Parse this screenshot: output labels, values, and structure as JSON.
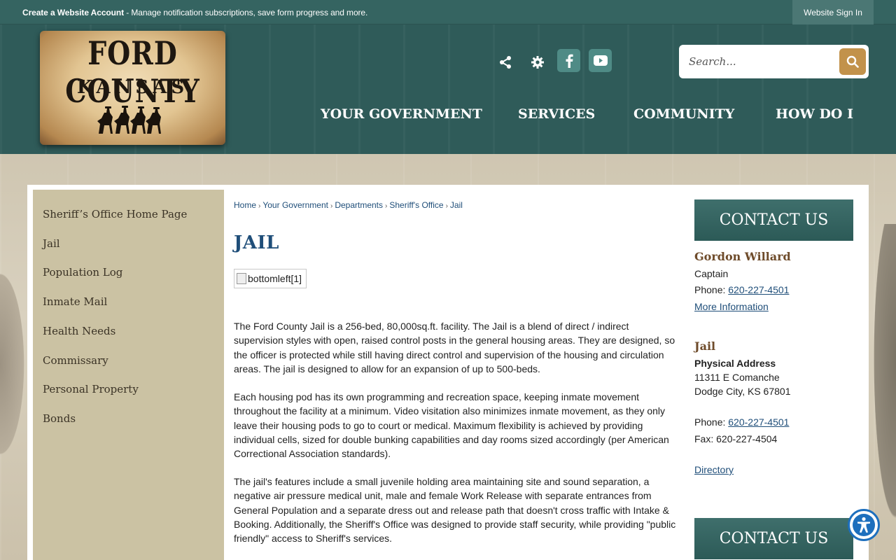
{
  "topbar": {
    "account_bold": "Create a Website Account",
    "account_rest": " - Manage notification subscriptions, save form progress and more.",
    "signin": "Website Sign In"
  },
  "logo": {
    "line1": "FORD COUNTY",
    "line2": "KANSAS"
  },
  "social": {
    "icons": [
      "share-icon",
      "gear-icon",
      "facebook-icon",
      "youtube-icon"
    ]
  },
  "search": {
    "placeholder": "Search..."
  },
  "nav": [
    "YOUR GOVERNMENT",
    "SERVICES",
    "COMMUNITY",
    "HOW DO I"
  ],
  "sidebar": {
    "items": [
      "Sheriff’s Office Home Page",
      "Jail",
      "Population Log",
      "Inmate Mail",
      "Health Needs",
      "Commissary",
      "Personal Property",
      "Bonds"
    ]
  },
  "breadcrumb": [
    "Home",
    "Your Government",
    "Departments",
    "Sheriff's Office",
    "Jail"
  ],
  "page": {
    "title": "JAIL",
    "image_alt": "bottomleft[1]",
    "paragraphs": [
      "The Ford County Jail is a 256-bed, 80,000sq.ft. facility. The Jail is a blend of direct / indirect supervision styles with open, raised control posts in the general housing areas. They are designed, so the officer is protected while still having direct control and supervision of the housing and circulation areas. The jail is designed to allow for an expansion of up to 500-beds.",
      "Each housing pod has its own programming and recreation space, keeping inmate movement throughout the facility at a minimum. Video visitation also minimizes inmate movement, as they only leave their housing pods to go to court or medical. Maximum flexibility is achieved by providing individual cells, sized for double bunking capabilities and day rooms sized accordingly (per American Correctional Association standards).",
      "The jail's features include a small juvenile holding area maintaining site and sound separation, a negative air pressure medical unit, male and female Work Release with separate entrances from General Population and a separate dress out and release path that doesn't cross traffic with Intake & Booking. Additionally, the Sheriff's Office was designed to provide staff security, while providing \"public friendly\" access to Sheriff's services."
    ]
  },
  "contact": {
    "heading": "CONTACT US",
    "person": {
      "name": "Gordon Willard",
      "role": "Captain",
      "phone_label": "Phone: ",
      "phone": "620-227-4501",
      "more": "More Information"
    },
    "office": {
      "name": "Jail",
      "address_label": "Physical Address",
      "street": "11311 E Comanche",
      "city": "Dodge City, KS 67801",
      "phone_label": "Phone: ",
      "phone": "620-227-4501",
      "fax": "Fax: 620-227-4504",
      "directory": "Directory"
    },
    "heading2": "CONTACT US"
  },
  "colors": {
    "header": "#2f5b59",
    "topbar": "#356461",
    "accent_gold": "#c2924b",
    "link": "#1f4e79",
    "sidebar": "#cbc2a3"
  }
}
